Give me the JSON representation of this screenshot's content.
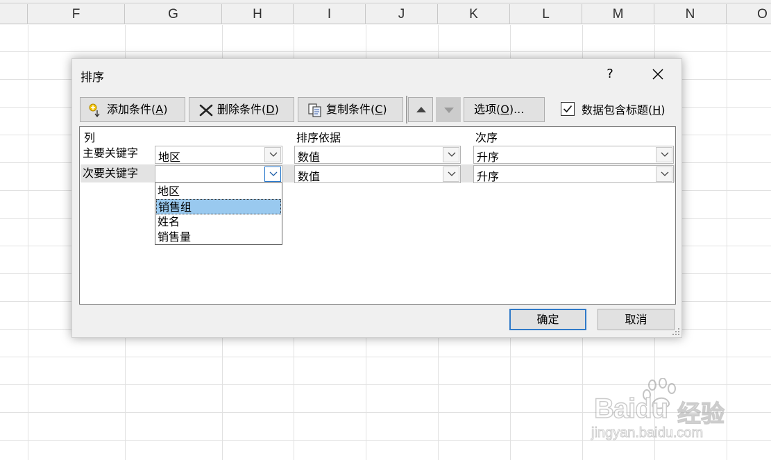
{
  "spreadsheet": {
    "columns": [
      "F",
      "G",
      "H",
      "I",
      "J",
      "K",
      "L",
      "M",
      "N",
      "O"
    ]
  },
  "dialog": {
    "title": "排序",
    "help": "?",
    "toolbar": {
      "add_label": "添加条件(",
      "add_key": "A",
      "delete_label": "删除条件(",
      "delete_key": "D",
      "copy_label": "复制条件(",
      "copy_key": "C",
      "options_label": "选项(",
      "options_key": "O",
      "options_suffix": ")...",
      "close_paren": ")"
    },
    "header_checkbox": {
      "label": "数据包含标题(",
      "key": "H",
      "checked": true
    },
    "columns": {
      "column": "列",
      "sort_on": "排序依据",
      "order": "次序"
    },
    "rows": [
      {
        "label": "主要关键字",
        "column_value": "地区",
        "sort_on": "数值",
        "order": "升序"
      },
      {
        "label": "次要关键字",
        "column_value": "",
        "sort_on": "数值",
        "order": "升序"
      }
    ],
    "dropdown_options": [
      "地区",
      "销售组",
      "姓名",
      "销售量"
    ],
    "dropdown_selected": "销售组",
    "ok": "确定",
    "cancel": "取消"
  },
  "watermark": {
    "brand": "Baidu",
    "brand_cn": "经验",
    "url": "jingyan.baidu.com"
  },
  "colors": {
    "dialog_bg": "#f0f0f0",
    "selection": "#99c9ef",
    "focus_border": "#2f79c8"
  }
}
